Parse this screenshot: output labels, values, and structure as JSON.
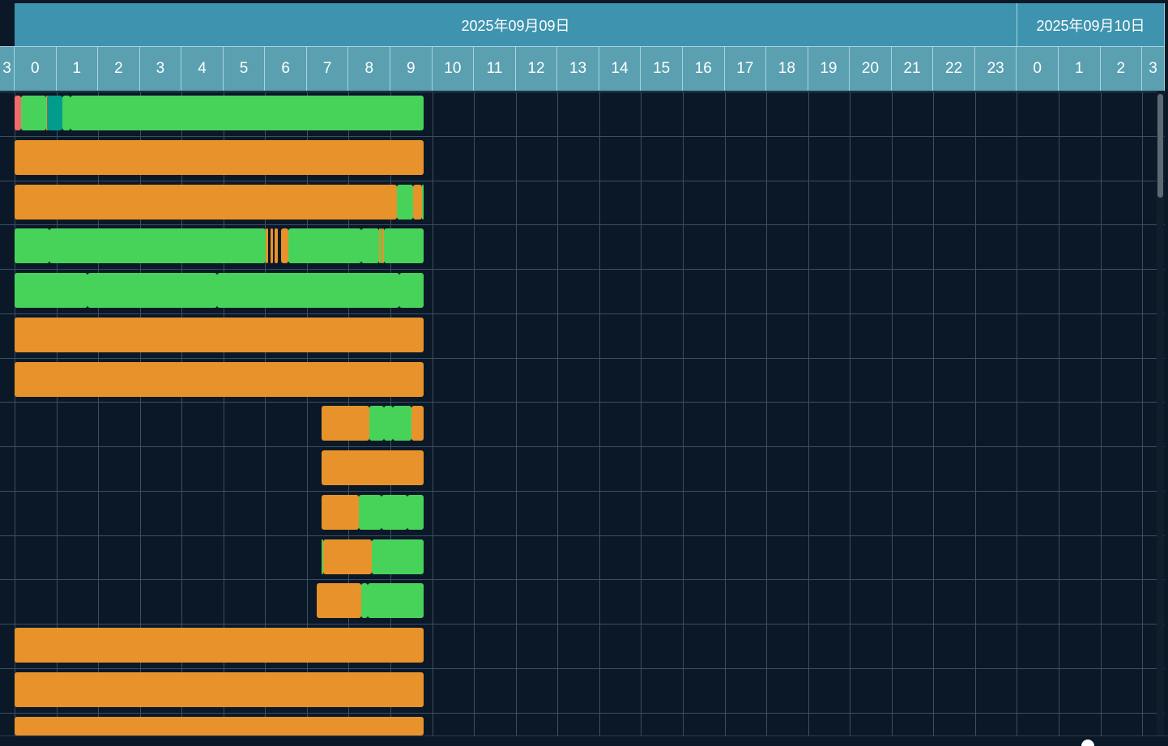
{
  "dates": [
    {
      "label": "2025年09月09日"
    },
    {
      "label": "2025年09月10日"
    }
  ],
  "hours": [
    "3",
    "0",
    "1",
    "2",
    "3",
    "4",
    "5",
    "6",
    "7",
    "8",
    "9",
    "10",
    "11",
    "12",
    "13",
    "14",
    "15",
    "16",
    "17",
    "18",
    "19",
    "20",
    "21",
    "22",
    "23",
    "0",
    "1",
    "2",
    "3"
  ],
  "colors": {
    "running": "#47d35a",
    "idle": "#e7922a",
    "alarm": "#f26a6a",
    "maintenance": "#029c8c",
    "grid": "#3c4f62",
    "background": "#0a1828",
    "date_header": "#3e93ae",
    "hour_header": "#5aa0b0"
  },
  "rows": [
    [
      [
        "alarm",
        0,
        0.15
      ],
      [
        "running",
        0.15,
        0.75
      ],
      [
        "idle",
        0.75,
        0.77
      ],
      [
        "maintenance",
        0.77,
        1.15
      ],
      [
        "running",
        1.15,
        1.33
      ],
      [
        "running",
        1.33,
        9.8
      ]
    ],
    [
      [
        "idle",
        0,
        9.8
      ]
    ],
    [
      [
        "idle",
        0,
        9.15
      ],
      [
        "running",
        9.15,
        9.55
      ],
      [
        "idle",
        9.55,
        9.75
      ],
      [
        "running",
        9.75,
        9.8
      ]
    ],
    [
      [
        "running",
        0,
        0.84
      ],
      [
        "running",
        0.84,
        6.02
      ],
      [
        "idle",
        6.02,
        6.08
      ],
      [
        "idle",
        6.13,
        6.18
      ],
      [
        "idle",
        6.23,
        6.3
      ],
      [
        "idle",
        6.38,
        6.55
      ],
      [
        "running",
        6.55,
        8.3
      ],
      [
        "running",
        8.3,
        8.72
      ],
      [
        "idle",
        8.72,
        8.77
      ],
      [
        "running",
        8.77,
        8.8
      ],
      [
        "idle",
        8.8,
        8.85
      ],
      [
        "running",
        8.85,
        9.8
      ]
    ],
    [
      [
        "running",
        0,
        1.75
      ],
      [
        "running",
        1.75,
        4.85
      ],
      [
        "running",
        4.85,
        9.22
      ],
      [
        "running",
        9.22,
        9.8
      ]
    ],
    [
      [
        "idle",
        0,
        9.8
      ]
    ],
    [
      [
        "idle",
        0,
        9.8
      ]
    ],
    [
      [
        "idle",
        7.35,
        8.5
      ],
      [
        "running",
        8.5,
        8.85
      ],
      [
        "running",
        8.85,
        9.05
      ],
      [
        "running",
        9.05,
        9.5
      ],
      [
        "idle",
        9.5,
        9.8
      ]
    ],
    [
      [
        "idle",
        7.35,
        9.8
      ]
    ],
    [
      [
        "idle",
        7.35,
        8.25
      ],
      [
        "running",
        8.25,
        8.78
      ],
      [
        "running",
        8.78,
        9.4
      ],
      [
        "running",
        9.4,
        9.8
      ]
    ],
    [
      [
        "running",
        7.35,
        7.38
      ],
      [
        "idle",
        7.38,
        8.55
      ],
      [
        "running",
        8.55,
        9.8
      ]
    ],
    [
      [
        "idle",
        7.23,
        8.3
      ],
      [
        "running",
        8.3,
        8.45
      ],
      [
        "running",
        8.45,
        9.8
      ]
    ],
    [
      [
        "idle",
        0,
        9.8
      ]
    ],
    [
      [
        "idle",
        0,
        9.8
      ]
    ],
    [
      [
        "idle",
        0,
        9.8
      ]
    ]
  ]
}
